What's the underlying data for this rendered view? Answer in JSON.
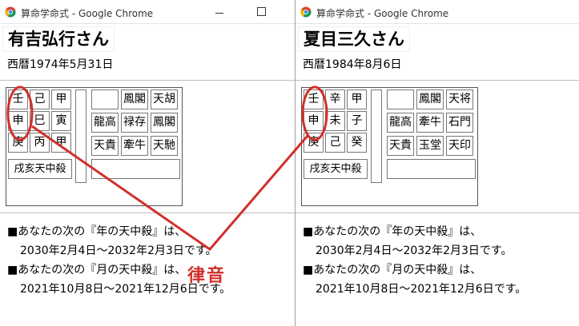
{
  "windows": [
    {
      "title": "算命学命式 - Google Chrome",
      "name": "有吉弘行さん",
      "birth": "西暦1974年5月31日",
      "pillars": [
        [
          "壬",
          "己",
          "甲"
        ],
        [
          "申",
          "巳",
          "寅"
        ],
        [
          "庚",
          "丙",
          "甲"
        ]
      ],
      "stars": [
        [
          "",
          "鳳閣",
          "天胡"
        ],
        [
          "龍高",
          "禄存",
          "鳳閣"
        ],
        [
          "天貴",
          "牽牛",
          "天馳"
        ]
      ],
      "tenchusatsu": "戌亥天中殺",
      "info": [
        "■あなたの次の『年の天中殺』は、",
        "2030年2月4日～2032年2月3日です。",
        "■あなたの次の『月の天中殺』は、",
        "2021年10月8日～2021年12月6日です。"
      ]
    },
    {
      "title": "算命学命式 - Google Chrome",
      "name": "夏目三久さん",
      "birth": "西暦1984年8月6日",
      "pillars": [
        [
          "壬",
          "辛",
          "甲"
        ],
        [
          "申",
          "未",
          "子"
        ],
        [
          "庚",
          "己",
          "癸"
        ]
      ],
      "stars": [
        [
          "",
          "鳳閣",
          "天将"
        ],
        [
          "龍高",
          "牽牛",
          "石門"
        ],
        [
          "天貴",
          "玉堂",
          "天印"
        ]
      ],
      "tenchusatsu": "戌亥天中殺",
      "info": [
        "■あなたの次の『年の天中殺』は、",
        "2030年2月4日～2032年2月3日です。",
        "■あなたの次の『月の天中殺』は、",
        "2021年10月8日～2021年12月6日です。"
      ]
    }
  ],
  "annotation": {
    "label": "律音",
    "color": "#d0302a"
  }
}
